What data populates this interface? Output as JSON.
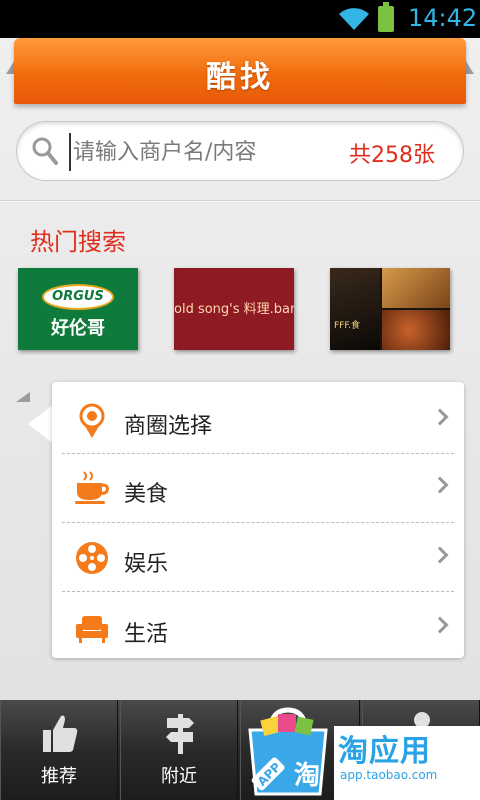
{
  "status_bar": {
    "time": "14:42",
    "icons": [
      "wifi-icon",
      "battery-icon"
    ],
    "accent": "#33b5e5"
  },
  "header": {
    "title": "酷找",
    "color": "#f16c0c"
  },
  "search": {
    "placeholder": "请输入商户名/内容",
    "count_label": "共258张",
    "count_color": "#e02d1c",
    "icon": "search-icon"
  },
  "hot_search": {
    "title": "热门搜索",
    "items": [
      {
        "logo_text": "ORGUS",
        "caption": "好伦哥"
      },
      {
        "text": "old song's 料理.bar"
      },
      {
        "caption": "FFF.食"
      }
    ]
  },
  "menu": {
    "items": [
      {
        "label": "商圈选择",
        "icon": "location-pin-icon"
      },
      {
        "label": "美食",
        "icon": "coffee-cup-icon"
      },
      {
        "label": "娱乐",
        "icon": "film-reel-icon"
      },
      {
        "label": "生活",
        "icon": "armchair-icon"
      }
    ],
    "icon_color": "#f57a1a"
  },
  "bottom_nav": {
    "items": [
      {
        "label": "推荐",
        "icon": "thumbs-up-icon"
      },
      {
        "label": "附近",
        "icon": "signpost-icon"
      },
      {
        "label": "",
        "icon": "shopping-bag-icon"
      },
      {
        "label": "",
        "icon": "user-icon"
      }
    ]
  },
  "promo": {
    "title": "淘应用",
    "url": "app.taobao.com",
    "bag_text": "淘",
    "bag_badge": "APP",
    "color": "#2aa3e6"
  }
}
